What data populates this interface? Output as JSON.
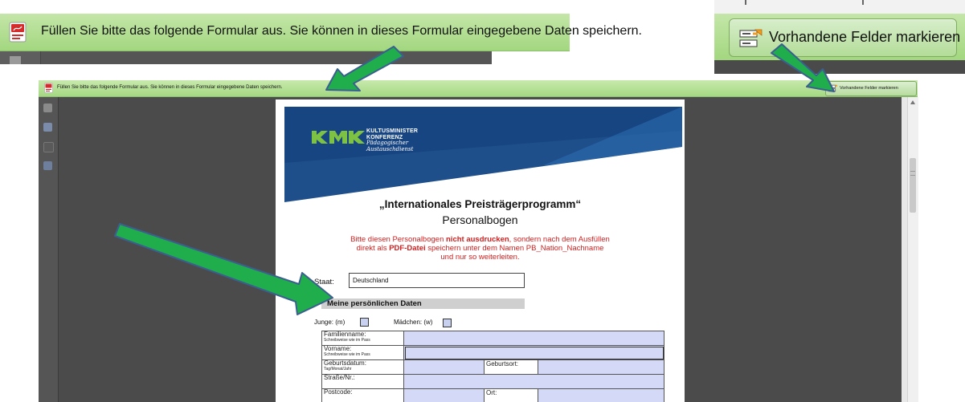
{
  "zoom_banner": {
    "message": "Füllen Sie bitte das folgende Formular aus. Sie können in dieses Formular eingegebene Daten speichern."
  },
  "zoom_button": {
    "label": "Vorhandene Felder markieren"
  },
  "app": {
    "banner_message": "Füllen Sie bitte das folgende Formular aus. Sie können in dieses Formular eingegebene Daten speichern.",
    "highlight_button_label": "Vorhandene Felder markieren"
  },
  "pdf": {
    "logo": {
      "line1": "KULTUSMINISTER",
      "line2": "KONFERENZ",
      "line3": "Pädagogischer",
      "line4": "Austauschdienst"
    },
    "title": "„Internationales Preisträgerprogramm“",
    "subtitle": "Personalbogen",
    "notice": {
      "part1": "Bitte diesen Personalbogen ",
      "bold1": "nicht ausdrucken",
      "part2": ", sondern nach dem Ausfüllen",
      "part3": "direkt als ",
      "bold2": "PDF-Datei",
      "part4": " speichern unter dem Namen PB_Nation_Nachname",
      "part5": "und nur so weiterleiten."
    },
    "staat": {
      "label": "Staat:",
      "value": "Deutschland"
    },
    "section_title": "Meine persönlichen Daten",
    "gender": {
      "male_label": "Junge:  (m)",
      "female_label": "Mädchen:  (w)"
    },
    "rows": [
      {
        "label": "Familienname:",
        "hint": "Schreibweise wie im Pass"
      },
      {
        "label": "Vorname:",
        "hint": "Schreibweise wie im Pass"
      },
      {
        "label": "Geburtsdatum:",
        "hint": "Tag/Monat/Jahr",
        "mid_label": "Geburtsort:"
      },
      {
        "label": "Straße/Nr.:"
      },
      {
        "label": "Postcode:",
        "mid_label": "Ort:"
      }
    ]
  },
  "colors": {
    "banner_green": "#a3d77f",
    "viewer_gray": "#4b4b4b",
    "field_blue": "#d3d9f6",
    "notice_red": "#d22020",
    "arrow_green": "#1fae4b",
    "arrow_outline": "#3b5f8f",
    "kmk_blue": "#1e4f8a"
  }
}
